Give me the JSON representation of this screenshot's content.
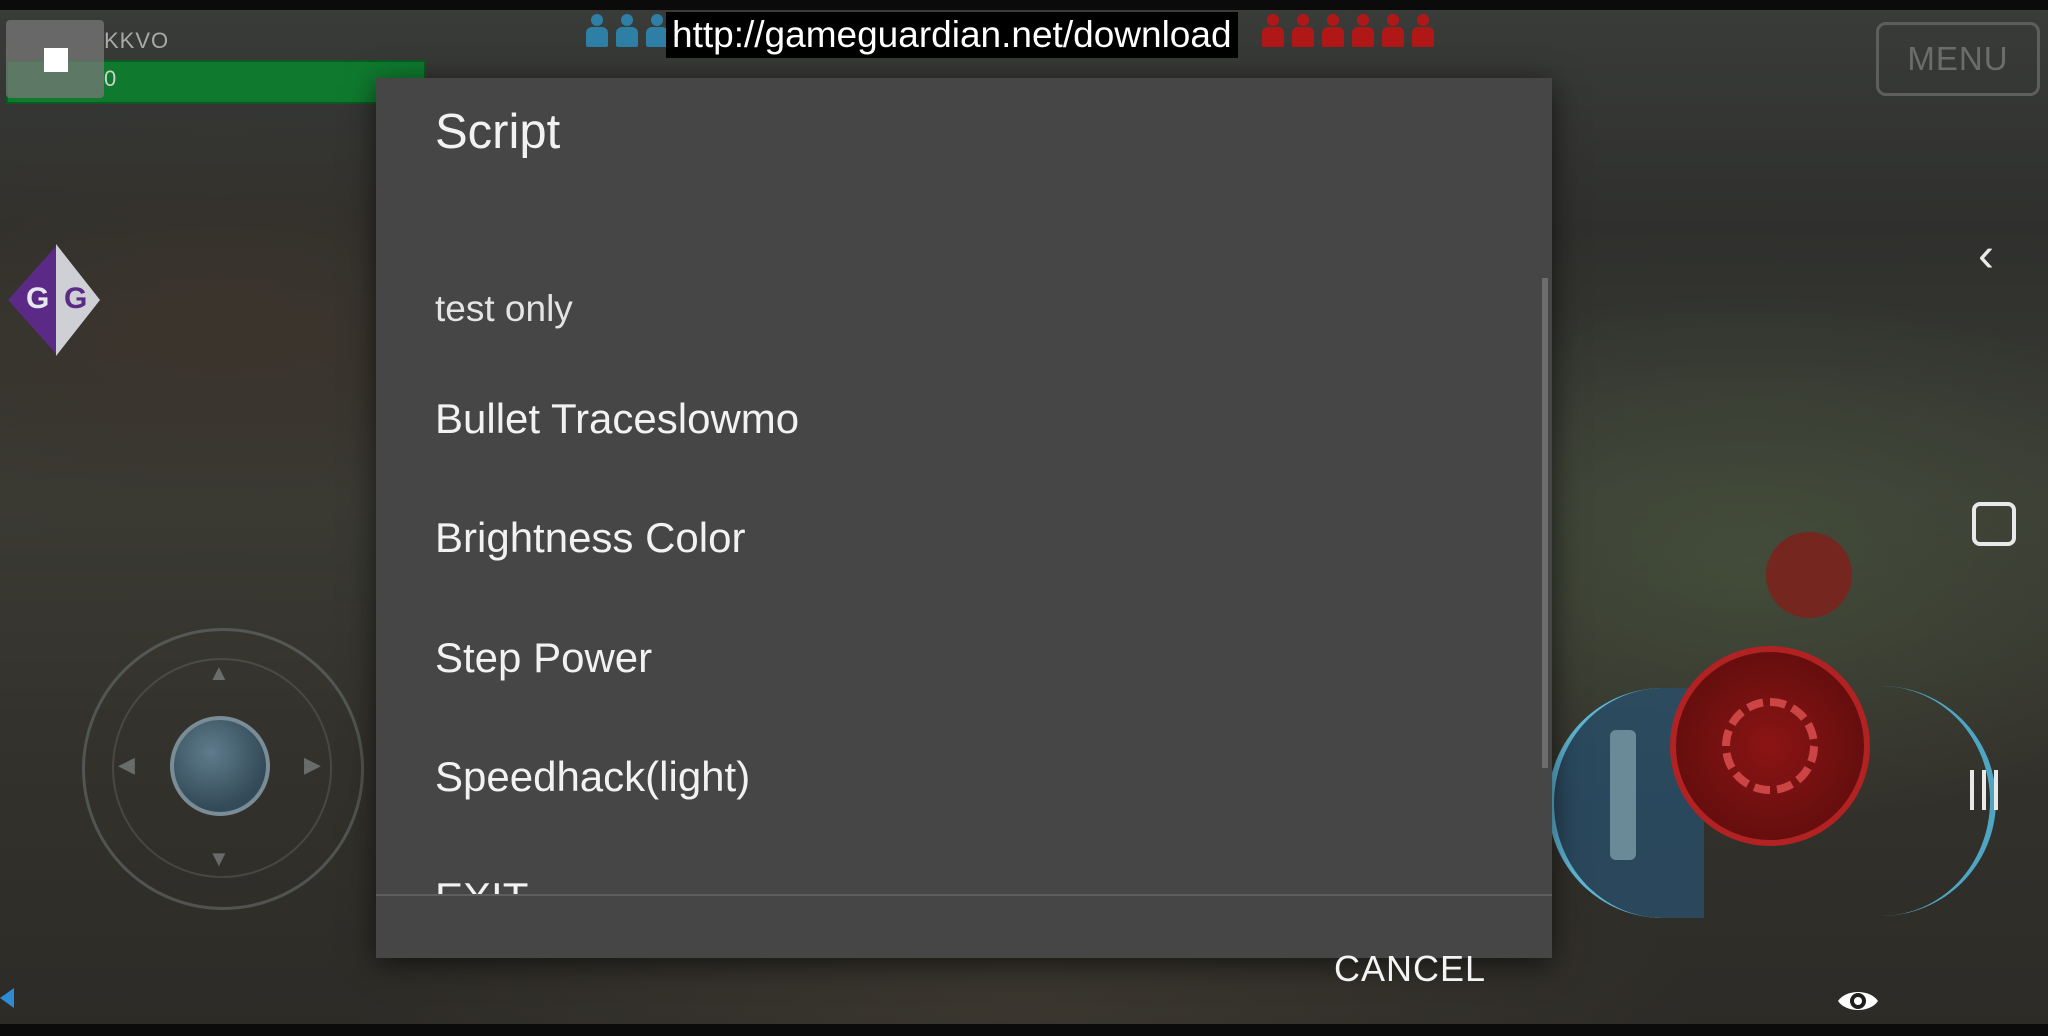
{
  "overlay": {
    "url_banner": "http://gameguardian.net/download",
    "menu_label": "MENU",
    "player_name": "KKVO",
    "health_value": "0"
  },
  "dialog": {
    "title": "Script",
    "items": [
      {
        "label": "test only"
      },
      {
        "label": "Bullet Traceslowmo"
      },
      {
        "label": "Brightness Color"
      },
      {
        "label": "Step Power"
      },
      {
        "label": "Speedhack(light)"
      },
      {
        "label": "EXIT"
      }
    ],
    "cancel_label": "CANCEL"
  },
  "colors": {
    "dialog_bg": "#464646",
    "health_green": "#0f7a2e",
    "team_blue": "#2e7fa6",
    "team_red": "#b01818"
  },
  "icons": {
    "stop": "stop-icon",
    "logo": "gameguardian-logo-icon",
    "back": "nav-back-icon",
    "home": "nav-home-icon",
    "recent": "nav-recent-icon",
    "eye": "eye-icon"
  }
}
